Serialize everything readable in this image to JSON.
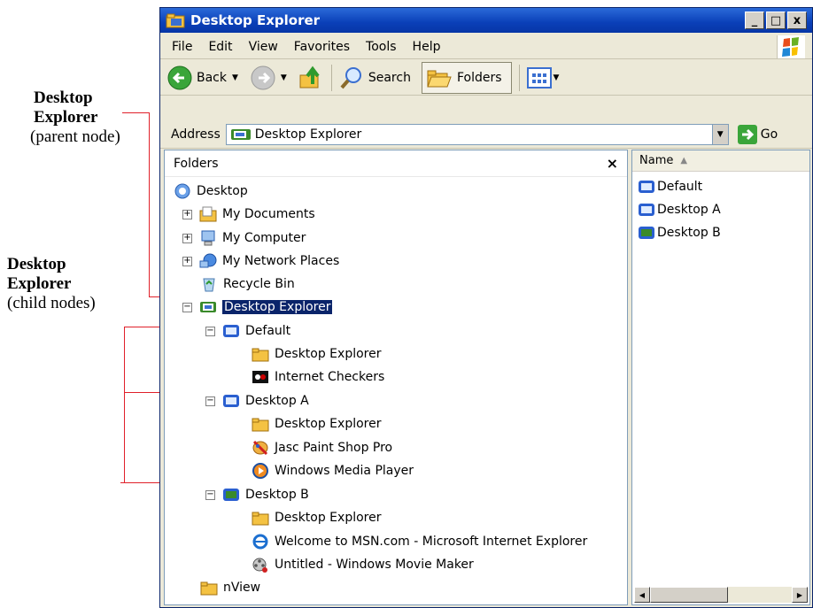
{
  "annotations": {
    "parent": {
      "title": "Desktop Explorer",
      "subtitle": "(parent node)"
    },
    "child": {
      "title": "Desktop Explorer",
      "subtitle": "(child nodes)"
    }
  },
  "window": {
    "title": "Desktop Explorer",
    "controls": {
      "minimize": "_",
      "maximize": "□",
      "close": "x"
    }
  },
  "menu": [
    {
      "label": "File"
    },
    {
      "label": "Edit"
    },
    {
      "label": "View"
    },
    {
      "label": "Favorites"
    },
    {
      "label": "Tools"
    },
    {
      "label": "Help"
    }
  ],
  "toolbar": {
    "back_label": "Back",
    "search_label": "Search",
    "folders_label": "Folders"
  },
  "address": {
    "label": "Address",
    "value": "Desktop Explorer",
    "go_label": "Go"
  },
  "folders_pane": {
    "title": "Folders",
    "close": "×"
  },
  "tree": [
    {
      "label": "Desktop"
    },
    {
      "label": "My Documents"
    },
    {
      "label": "My Computer"
    },
    {
      "label": "My Network Places"
    },
    {
      "label": "Recycle Bin"
    },
    {
      "label": "Desktop Explorer"
    },
    {
      "label": "Default"
    },
    {
      "label": "Desktop Explorer"
    },
    {
      "label": "Internet Checkers"
    },
    {
      "label": "Desktop A"
    },
    {
      "label": "Desktop Explorer"
    },
    {
      "label": "Jasc Paint Shop Pro"
    },
    {
      "label": "Windows Media Player"
    },
    {
      "label": "Desktop B"
    },
    {
      "label": "Desktop Explorer"
    },
    {
      "label": "Welcome to MSN.com - Microsoft Internet Explorer"
    },
    {
      "label": "Untitled - Windows Movie Maker"
    },
    {
      "label": "nView"
    }
  ],
  "list_pane": {
    "column": "Name",
    "items": [
      {
        "label": "Default"
      },
      {
        "label": "Desktop A"
      },
      {
        "label": "Desktop B"
      }
    ]
  },
  "colors": {
    "selection": "#0a246a",
    "annotation_line": "#e0202a",
    "titlebar": "#0a3fb8"
  }
}
